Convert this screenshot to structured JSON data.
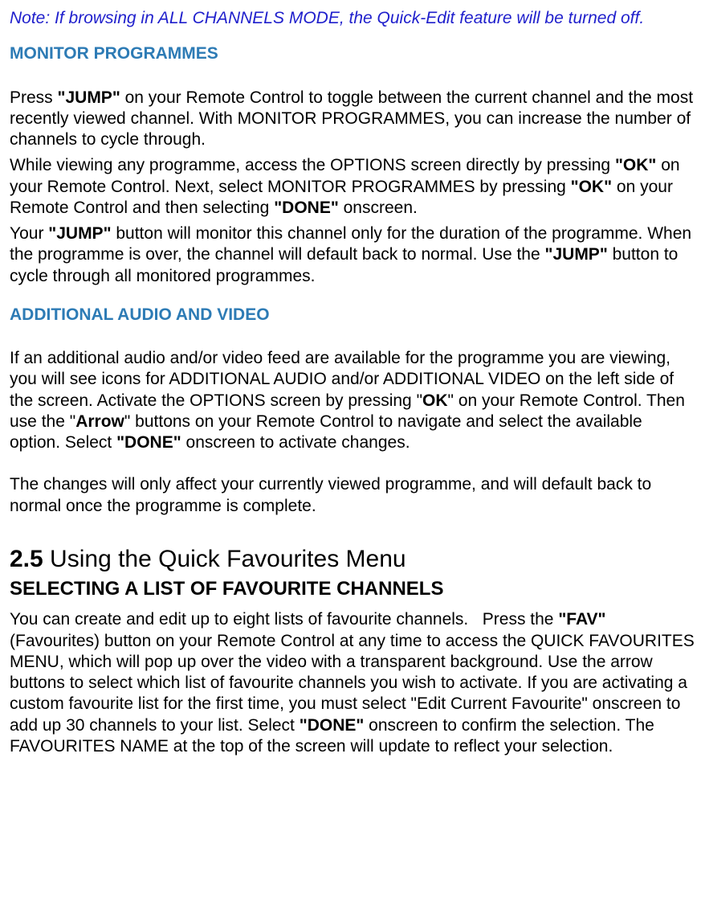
{
  "note": "Note: If browsing in ALL CHANNELS MODE, the Quick-Edit feature will be turned off.",
  "h_monitor": "MONITOR PROGRAMMES",
  "mp1a": "Press ",
  "mp1b": "\"JUMP\"",
  "mp1c": " on your Remote Control to toggle between the current channel and the most recently viewed channel. With MONITOR PROGRAMMES, you can increase the number of channels to cycle through.",
  "mp2a": "While viewing any programme, access the OPTIONS screen directly by pressing ",
  "mp2b": "\"OK\"",
  "mp2c": " on your Remote Control. Next, select MONITOR PROGRAMMES by pressing ",
  "mp2d": "\"OK\"",
  "mp2e": " on your Remote Control and then selecting ",
  "mp2f": "\"DONE\"",
  "mp2g": " onscreen.",
  "mp3a": "Your ",
  "mp3b": "\"JUMP\"",
  "mp3c": " button will monitor this channel only for the duration of the programme. When the programme is over, the channel will default back to normal. Use the ",
  "mp3d": "\"JUMP\"",
  "mp3e": " button to cycle through all monitored programmes.",
  "h_audio": "ADDITIONAL AUDIO AND VIDEO",
  "av1a": "If an additional audio and/or video feed are available for the programme you are viewing, you will see icons for ADDITIONAL AUDIO and/or ADDITIONAL VIDEO on the left side of the screen. Activate the OPTIONS screen by pressing \"",
  "av1b": "OK",
  "av1c": "\" on your Remote Control. Then use the \"",
  "av1d": "Arrow",
  "av1e": "\" buttons on your Remote Control to navigate and select the available option. Select ",
  "av1f": "\"DONE\"",
  "av1g": " onscreen to activate changes.",
  "av2": "The changes will only affect your currently viewed programme, and will default back to normal once the programme is complete.",
  "sec_num": "2.5",
  "sec_title": " Using the Quick Favourites Menu",
  "sub_fav": "SELECTING A LIST OF FAVOURITE CHANNELS",
  "fav1a": "You can create and edit up to eight lists of favourite channels.   Press the ",
  "fav1b": "\"FAV\"",
  "fav1c": " (Favourites) button on your Remote Control at any time to access the QUICK FAVOURITES MENU, which will pop up over the video with a transparent background. Use the arrow buttons to select which list of favourite channels you wish to activate. If you are activating a custom favourite list for the first time, you must select \"Edit Current Favourite\" onscreen to add up 30 channels to your list. Select ",
  "fav1d": "\"DONE\"",
  "fav1e": " onscreen to confirm the selection. The FAVOURITES NAME at the top of the screen will update to reflect your selection."
}
